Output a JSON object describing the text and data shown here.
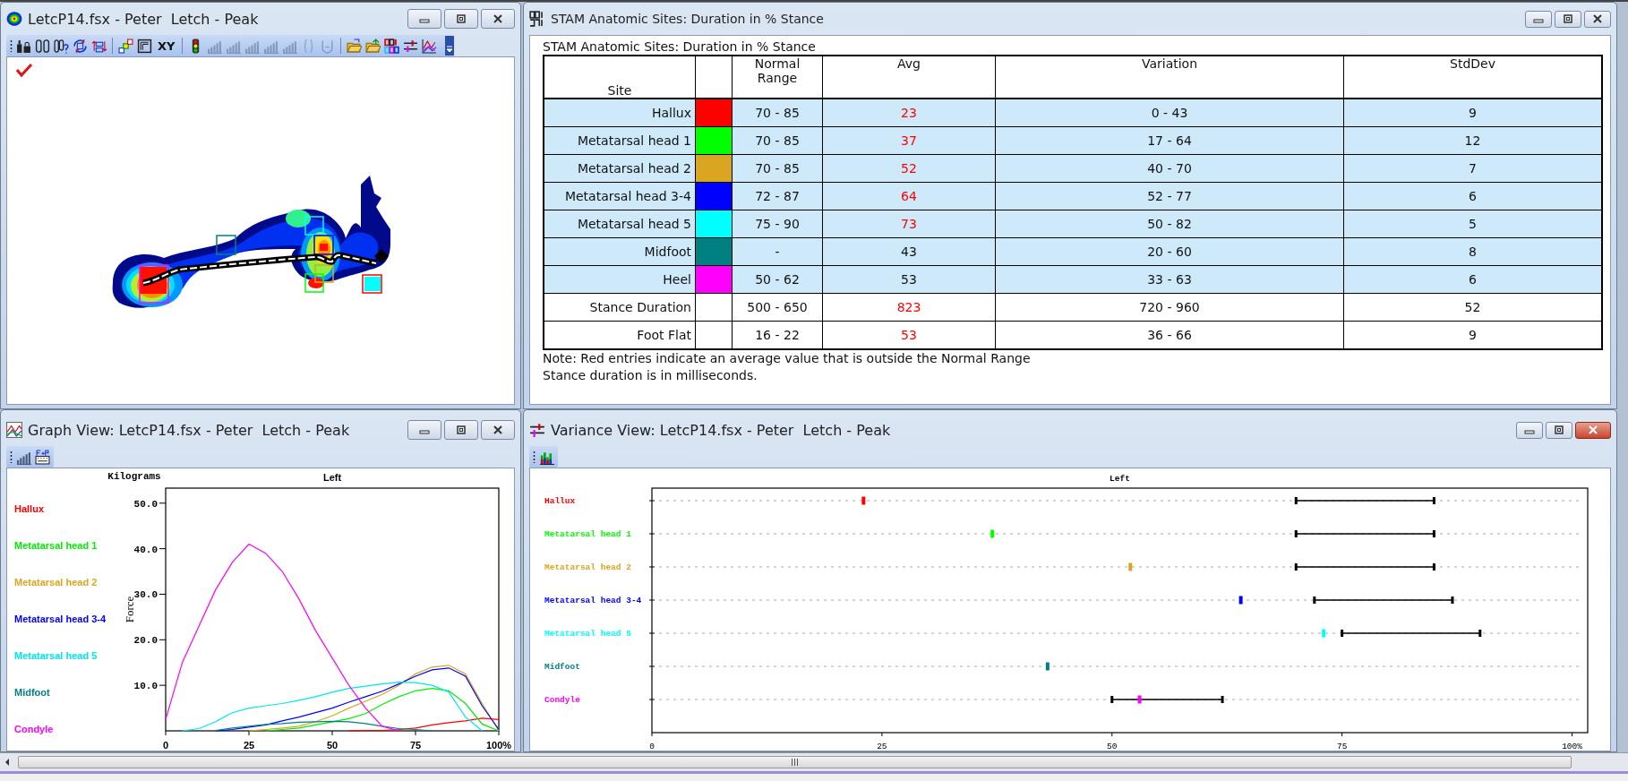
{
  "windows": [
    {
      "kind": "map",
      "title": "LetcP14.fsx - Peter  Letch - Peak",
      "active": false,
      "toolbar": [
        {
          "kind": "icon",
          "disabled": false
        },
        {
          "kind": "icon",
          "disabled": false
        },
        {
          "kind": "icon",
          "disabled": false
        },
        {
          "kind": "icon",
          "disabled": false
        },
        {
          "kind": "icon",
          "disabled": false
        },
        {
          "kind": "separator"
        },
        {
          "kind": "icon",
          "disabled": false
        },
        {
          "kind": "icon",
          "disabled": false
        },
        {
          "kind": "text",
          "label": "XY",
          "disabled": false
        },
        {
          "kind": "separator"
        },
        {
          "kind": "icon",
          "disabled": false
        },
        {
          "kind": "icon",
          "disabled": true
        },
        {
          "kind": "icon",
          "disabled": true
        },
        {
          "kind": "icon",
          "disabled": true
        },
        {
          "kind": "icon",
          "disabled": true
        },
        {
          "kind": "icon",
          "disabled": true
        },
        {
          "kind": "icon",
          "disabled": true
        },
        {
          "kind": "icon",
          "disabled": true
        },
        {
          "kind": "separator"
        },
        {
          "kind": "icon",
          "disabled": false
        },
        {
          "kind": "icon",
          "disabled": false
        },
        {
          "kind": "icon",
          "disabled": false
        },
        {
          "kind": "icon",
          "disabled": false
        },
        {
          "kind": "icon",
          "disabled": false
        }
      ]
    },
    {
      "kind": "table",
      "title": "STAM Anatomic Sites: Duration in % Stance",
      "active": false,
      "heading": "STAM Anatomic Sites: Duration in % Stance",
      "columns": {
        "site": "Site",
        "normal_range": "Normal Range",
        "avg": "Avg",
        "variation": "Variation",
        "stddev": "StdDev"
      },
      "rows": [
        {
          "kind": "site",
          "site": "Hallux",
          "color": "#ff0000",
          "normal_range": "70 - 85",
          "avg": "23",
          "out_of_range": true,
          "variation": "0 - 43",
          "stddev": "9"
        },
        {
          "kind": "site",
          "site": "Metatarsal head 1",
          "color": "#00ff00",
          "normal_range": "70 - 85",
          "avg": "37",
          "out_of_range": true,
          "variation": "17 - 64",
          "stddev": "12"
        },
        {
          "kind": "site",
          "site": "Metatarsal head 2",
          "color": "#daa520",
          "normal_range": "70 - 85",
          "avg": "52",
          "out_of_range": true,
          "variation": "40 - 70",
          "stddev": "7"
        },
        {
          "kind": "site",
          "site": "Metatarsal head 3-4",
          "color": "#0000ff",
          "normal_range": "72 - 87",
          "avg": "64",
          "out_of_range": true,
          "variation": "52 - 77",
          "stddev": "6"
        },
        {
          "kind": "site",
          "site": "Metatarsal head 5",
          "color": "#00ffff",
          "normal_range": "75 - 90",
          "avg": "73",
          "out_of_range": true,
          "variation": "50 - 82",
          "stddev": "5"
        },
        {
          "kind": "site",
          "site": "Midfoot",
          "color": "#008080",
          "normal_range": "-",
          "avg": "43",
          "out_of_range": false,
          "variation": "20 - 60",
          "stddev": "8"
        },
        {
          "kind": "site",
          "site": "Heel",
          "color": "#ff00ff",
          "normal_range": "50 - 62",
          "avg": "53",
          "out_of_range": false,
          "variation": "33 - 63",
          "stddev": "6"
        },
        {
          "kind": "summary",
          "site": "Stance Duration",
          "normal_range": "500 - 650",
          "avg": "823",
          "out_of_range": true,
          "variation": "720 - 960",
          "stddev": "52"
        },
        {
          "kind": "summary",
          "site": "Foot Flat",
          "normal_range": "16 - 22",
          "avg": "53",
          "out_of_range": true,
          "variation": "36 - 66",
          "stddev": "9"
        }
      ],
      "notes": [
        "Note: Red entries indicate an average value that is outside the Normal Range",
        "Stance duration is in milliseconds."
      ]
    },
    {
      "kind": "graph",
      "title": "Graph View: LetcP14.fsx - Peter  Letch - Peak",
      "active": false,
      "toolbar": [
        {
          "kind": "icon",
          "disabled": false
        },
        {
          "kind": "icon",
          "disabled": false
        }
      ],
      "units_label": "Kilograms",
      "chart_data": {
        "type": "line",
        "title": "Left",
        "ylabel": "Force",
        "x": [
          0,
          5,
          10,
          15,
          20,
          25,
          30,
          35,
          40,
          45,
          50,
          55,
          60,
          65,
          70,
          75,
          80,
          85,
          90,
          95,
          100
        ],
        "xlim": [
          0,
          100
        ],
        "ylim": [
          0,
          53.3
        ],
        "xticks": [
          0,
          25,
          50,
          75,
          {
            "value": 100,
            "label": "100%"
          }
        ],
        "yticks": [
          {
            "value": 10,
            "label": "10.0"
          },
          {
            "value": 20,
            "label": "20.0"
          },
          {
            "value": 30,
            "label": "30.0"
          },
          {
            "value": 40,
            "label": "40.0"
          },
          {
            "value": 50,
            "label": "50.0"
          }
        ],
        "series": [
          {
            "name": "Hallux",
            "color": "#ff0000",
            "values": [
              null,
              null,
              null,
              null,
              null,
              null,
              null,
              null,
              null,
              null,
              null,
              0,
              0.1,
              0.1,
              0.3,
              0.6,
              1.3,
              1.8,
              2.2,
              2.8,
              2.5
            ]
          },
          {
            "name": "Metatarsal head 1",
            "color": "#00ee00",
            "values": [
              null,
              null,
              null,
              null,
              null,
              null,
              0,
              0.3,
              0.6,
              1.3,
              2,
              2.7,
              3.8,
              5.8,
              7.5,
              8.8,
              9.3,
              8.8,
              6,
              1.5,
              0
            ]
          },
          {
            "name": "Metatarsal head 2",
            "color": "#daa520",
            "values": [
              null,
              null,
              null,
              null,
              null,
              0,
              0.3,
              0.6,
              1,
              2,
              3.3,
              5,
              6.5,
              8,
              10,
              12.5,
              14,
              14.4,
              12.5,
              6,
              0
            ]
          },
          {
            "name": "Metatarsal head 3-4",
            "color": "#0000ff",
            "values": [
              null,
              null,
              null,
              0,
              0.3,
              0.8,
              1.3,
              2.2,
              3,
              4,
              5,
              6.3,
              7.5,
              8.7,
              10.3,
              12,
              13.4,
              13.8,
              12,
              5.5,
              0.3
            ]
          },
          {
            "name": "Metatarsal head 5",
            "color": "#00e5ee",
            "values": [
              null,
              0,
              0.5,
              2,
              4,
              5,
              5.5,
              6,
              6.7,
              7.5,
              8.5,
              9.3,
              9.8,
              10.3,
              10.7,
              10.6,
              10,
              8.5,
              3,
              0,
              null
            ]
          },
          {
            "name": "Midfoot",
            "color": "#008080",
            "values": [
              null,
              null,
              null,
              0.1,
              0.6,
              1,
              1.4,
              1.6,
              1.9,
              2,
              2.1,
              2,
              1.6,
              1,
              0.5,
              0.3,
              0,
              null,
              null,
              null,
              null
            ]
          },
          {
            "name": "Condyle",
            "color": "#ff00ff",
            "values": [
              2.5,
              15,
              23,
              31,
              37,
              41,
              39,
              35,
              29,
              22,
              16,
              10,
              5,
              1,
              0,
              null,
              null,
              null,
              null,
              null,
              null
            ]
          }
        ]
      }
    },
    {
      "kind": "variance",
      "title": "Variance View: LetcP14.fsx - Peter  Letch - Peak",
      "active": true,
      "toolbar": [
        {
          "kind": "icon",
          "disabled": false
        }
      ],
      "chart_data": {
        "type": "scatter",
        "title": "Left",
        "orientation": "horizontal",
        "categories": [
          "Hallux",
          "Metatarsal head 1",
          "Metatarsal head 2",
          "Metatarsal head 3-4",
          "Metatarsal head 5",
          "Midfoot",
          "Condyle"
        ],
        "xlim": [
          0,
          101.7
        ],
        "xticks": [
          0,
          25,
          50,
          75,
          {
            "value": 100,
            "label": "100%"
          }
        ],
        "series": [
          {
            "colors": [
              "#ff0000",
              "#00ff00",
              "#daa520",
              "#0000ff",
              "#00ffff",
              "#008080",
              "#ff00ff"
            ],
            "values": [
              23,
              37,
              52,
              64,
              73,
              43,
              53
            ]
          },
          {
            "color": "#000000",
            "values": [
              70,
              70,
              70,
              72,
              75,
              null,
              50
            ]
          },
          {
            "color": "#000000",
            "values": [
              85,
              85,
              85,
              87,
              90,
              null,
              62
            ]
          }
        ]
      }
    }
  ]
}
